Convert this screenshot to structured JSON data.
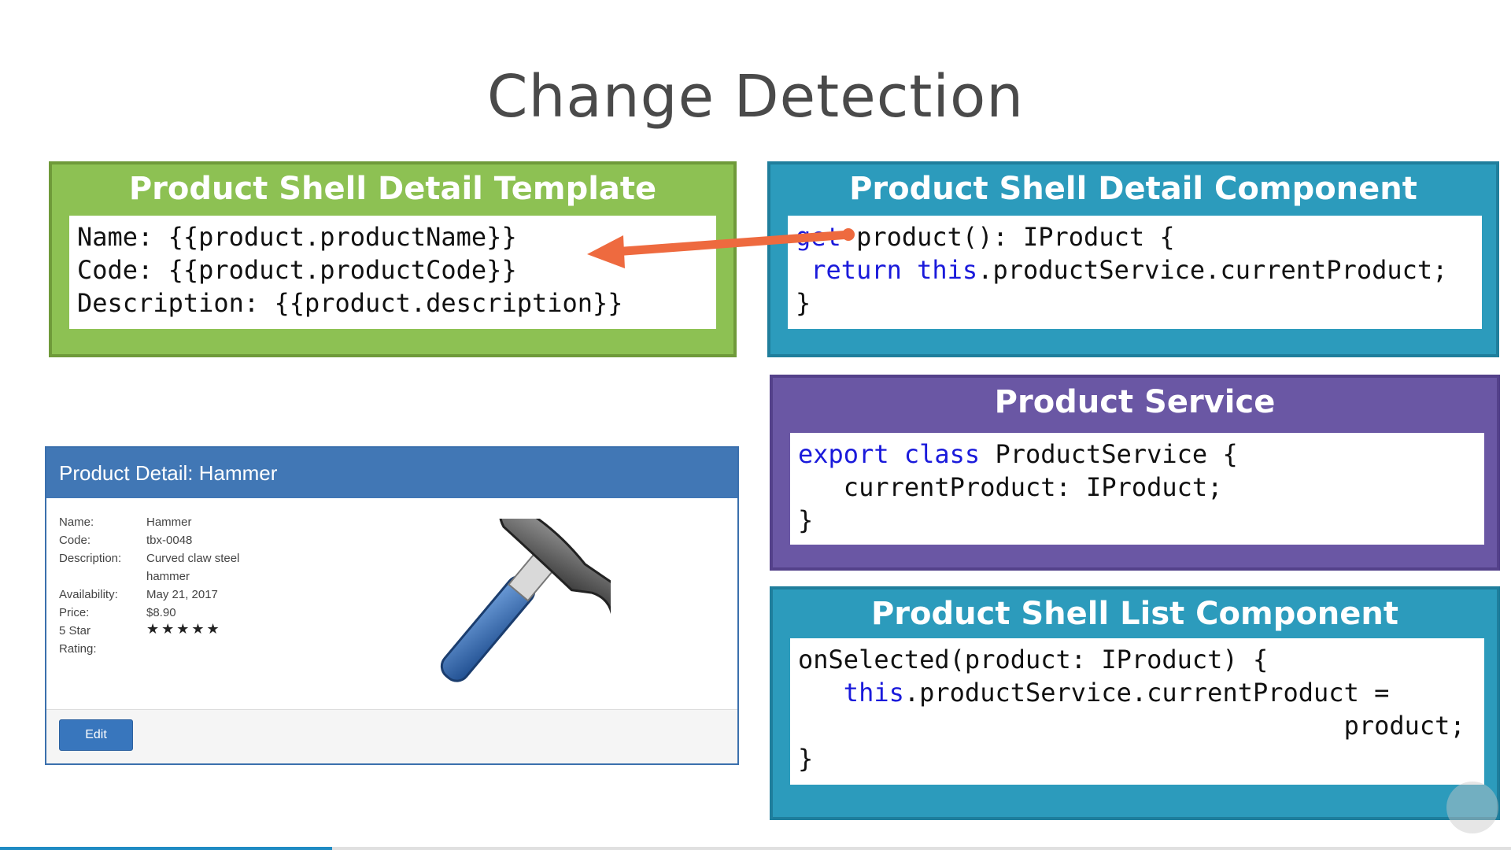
{
  "slide": {
    "title": "Change Detection"
  },
  "template_panel": {
    "title": "Product Shell Detail Template",
    "lines": [
      "Name: {{product.productName}}",
      "Code: {{product.productCode}}",
      "Description: {{product.description}}"
    ],
    "color": "#8dc153"
  },
  "component_panel": {
    "title": "Product Shell Detail Component",
    "line1_kw": "get",
    "line1_rest": " product(): IProduct {",
    "line2_kw1": " return",
    "line2_mid": " ",
    "line2_kw2": "this",
    "line2_rest": ".productService.currentProduct;",
    "line3": "}",
    "color": "#2c9bbc"
  },
  "service_panel": {
    "title": "Product Service",
    "line1_kw1": "export",
    "line1_kw2": "class",
    "line1_rest": " ProductService {",
    "line2": "   currentProduct: IProduct;",
    "line3": "}",
    "color": "#6a57a4"
  },
  "list_panel": {
    "title": "Product Shell List Component",
    "line1": "onSelected(product: IProduct) {",
    "line2_indent": "   ",
    "line2_kw": "this",
    "line2_rest": ".productService.currentProduct =",
    "line3": "                                    product;",
    "line4": "}",
    "color": "#2c9bbc"
  },
  "arrow": {
    "color": "#ee6a3f"
  },
  "product_card": {
    "header": "Product Detail: Hammer",
    "fields": [
      {
        "label": "Name:",
        "value": "Hammer"
      },
      {
        "label": "Code:",
        "value": "tbx-0048"
      },
      {
        "label": "Description:",
        "value": "Curved claw steel"
      },
      {
        "label": "",
        "value": "hammer"
      },
      {
        "label": "Availability:",
        "value": "May 21, 2017"
      },
      {
        "label": "Price:",
        "value": "$8.90"
      },
      {
        "label": "5 Star",
        "value": "★★★★★"
      },
      {
        "label": "Rating:",
        "value": ""
      }
    ],
    "rating_stars": 5,
    "edit_label": "Edit",
    "image_icon": "hammer-icon"
  },
  "player": {
    "progress_fraction": 0.22
  }
}
